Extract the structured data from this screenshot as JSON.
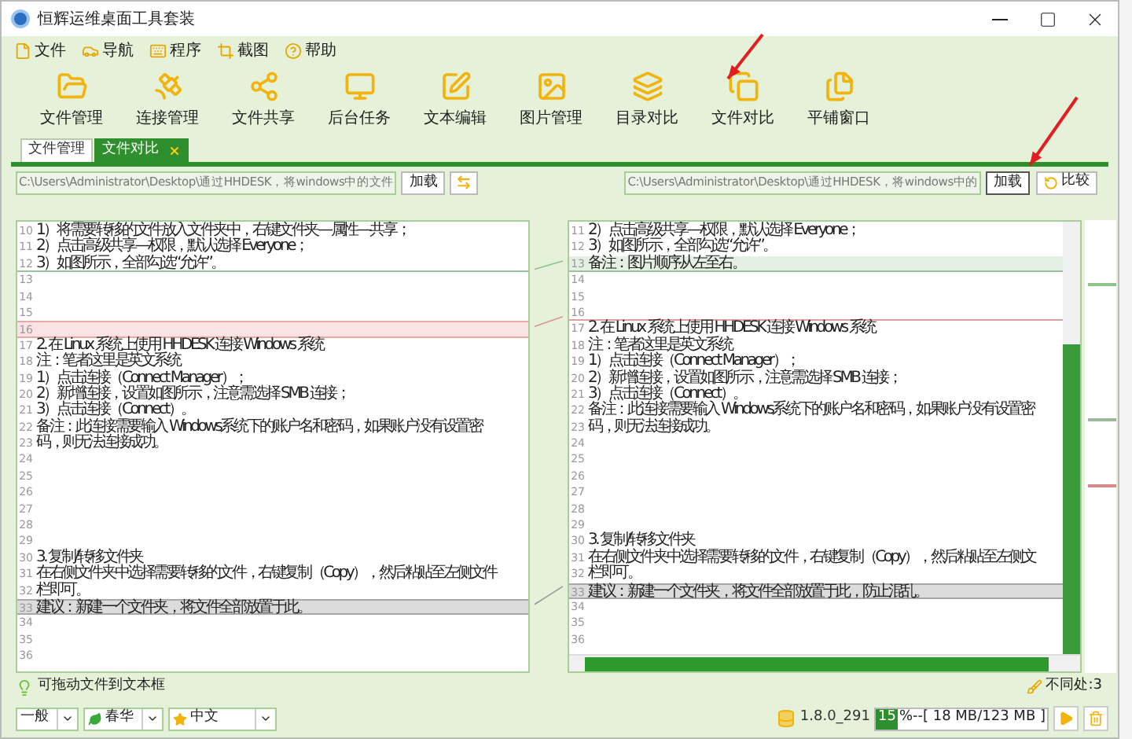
{
  "window": {
    "title": "恒辉运维桌面工具套装"
  },
  "menu": [
    "文件",
    "导航",
    "程序",
    "截图",
    "帮助"
  ],
  "toolbar": [
    "文件管理",
    "连接管理",
    "文件共享",
    "后台任务",
    "文本编辑",
    "图片管理",
    "目录对比",
    "文件对比",
    "平铺窗口"
  ],
  "tabs": [
    {
      "label": "文件管理",
      "selected": false,
      "closable": false
    },
    {
      "label": "文件对比",
      "selected": true,
      "closable": true
    }
  ],
  "left_path": {
    "value": "C:\\Users\\Administrator\\Desktop\\通过HHDESK，将windows中的文件",
    "load": "加载"
  },
  "right_path": {
    "value": "C:\\Users\\Administrator\\Desktop\\通过HHDESK，将windows中的",
    "load": "加载",
    "compare": "比较"
  },
  "left_editor": {
    "lines": [
      {
        "no": "10",
        "text": "1）将需要转移的文件放入文件夹中，右键文件夹—属性—共享；",
        "kind": "plain"
      },
      {
        "no": "11",
        "text": "2）点击高级共享—权限，默认选择 Everyone；",
        "kind": "plain"
      },
      {
        "no": "12",
        "text": "3）如图所示，全部勾选“允许”。",
        "kind": "gap_below"
      },
      {
        "no": "13",
        "kind": "plain"
      },
      {
        "no": "14",
        "kind": "plain"
      },
      {
        "no": "15",
        "kind": "plain"
      },
      {
        "no": "16",
        "kind": "removed"
      },
      {
        "no": "17",
        "text": "2. 在 Linux 系统上使用 HHDESK 连接 Windows 系统",
        "kind": "plain"
      },
      {
        "no": "18",
        "text": "注：笔者这里是英文系统",
        "kind": "plain"
      },
      {
        "no": "19",
        "text": "1）点击连接（Connect Manager）；",
        "kind": "plain"
      },
      {
        "no": "20",
        "text": "2）新增连接，设置如图所示，注意需选择 SMB 连接；",
        "kind": "plain"
      },
      {
        "no": "21",
        "text": "3）点击连接（Connect）。",
        "kind": "plain"
      },
      {
        "no": "22",
        "text": "备注：此连接需要输入 Windows系统下的账户名和密码，如果账户没有设置密",
        "kind": "plain"
      },
      {
        "no": "23",
        "text": "码，则无法连接成功。",
        "kind": "plain"
      },
      {
        "no": "24",
        "kind": "plain"
      },
      {
        "no": "25",
        "kind": "plain"
      },
      {
        "no": "26",
        "kind": "plain"
      },
      {
        "no": "27",
        "kind": "plain"
      },
      {
        "no": "28",
        "kind": "plain"
      },
      {
        "no": "29",
        "kind": "plain"
      },
      {
        "no": "30",
        "text": "3. 复制/转移文件夹",
        "kind": "plain"
      },
      {
        "no": "31",
        "text": "在右侧文件夹中选择需要转移的文件，右键复制（Copy），然后粘贴至左侧文件",
        "kind": "plain"
      },
      {
        "no": "32",
        "text": "栏即可。",
        "kind": "plain"
      },
      {
        "no": "33",
        "text": "建议：新建一个文件夹，将文件全部放置于此。",
        "kind": "changed"
      },
      {
        "no": "34",
        "kind": "plain"
      },
      {
        "no": "35",
        "kind": "plain"
      },
      {
        "no": "36",
        "kind": "plain"
      }
    ]
  },
  "right_editor": {
    "lines": [
      {
        "no": "11",
        "text": "2）点击高级共享—权限，默认选择 Everyone；",
        "kind": "plain"
      },
      {
        "no": "12",
        "text": "3）如图所示，全部勾选“允许”。",
        "kind": "plain"
      },
      {
        "no": "13",
        "text": "备注：图片顺序从左至右。",
        "kind": "added"
      },
      {
        "no": "14",
        "kind": "plain"
      },
      {
        "no": "15",
        "kind": "plain"
      },
      {
        "no": "16",
        "kind": "gap_below_removed"
      },
      {
        "no": "17",
        "text": "2. 在 Linux 系统上使用 HHDESK 连接 Windows 系统",
        "kind": "plain"
      },
      {
        "no": "18",
        "text": "注：笔者这里是英文系统",
        "kind": "plain"
      },
      {
        "no": "19",
        "text": "1）点击连接（Connect Manager）；",
        "kind": "plain"
      },
      {
        "no": "20",
        "text": "2）新增连接，设置如图所示，注意需选择 SMB 连接；",
        "kind": "plain"
      },
      {
        "no": "21",
        "text": "3）点击连接（Connect）。",
        "kind": "plain"
      },
      {
        "no": "22",
        "text": "备注：此连接需要输入 Windows系统下的账户名和密码，如果账户没有设置密",
        "kind": "plain"
      },
      {
        "no": "23",
        "text": "码，则无法连接成功。",
        "kind": "plain"
      },
      {
        "no": "24",
        "kind": "plain"
      },
      {
        "no": "25",
        "kind": "plain"
      },
      {
        "no": "26",
        "kind": "plain"
      },
      {
        "no": "27",
        "kind": "plain"
      },
      {
        "no": "28",
        "kind": "plain"
      },
      {
        "no": "29",
        "kind": "plain"
      },
      {
        "no": "30",
        "text": "3. 复制/转移文件夹",
        "kind": "plain"
      },
      {
        "no": "31",
        "text": "在右侧文件夹中选择需要转移的文件，右键复制（Copy），然后粘贴至左侧文",
        "kind": "plain"
      },
      {
        "no": "32",
        "text": "栏即可。",
        "kind": "plain"
      },
      {
        "no": "33",
        "text": "建议：新建一个文件夹，将文件全部放置于此，防止混乱。",
        "kind": "changed"
      },
      {
        "no": "34",
        "kind": "plain"
      },
      {
        "no": "35",
        "kind": "plain"
      },
      {
        "no": "36",
        "kind": "plain"
      }
    ]
  },
  "hint": "可拖动文件到文本框",
  "differences": "不同处:3",
  "selectors": [
    {
      "label": "一般",
      "kind": "plain"
    },
    {
      "label": "春华",
      "kind": "leaf"
    },
    {
      "label": "中文",
      "kind": "star"
    }
  ],
  "status": {
    "version": "1.8.0_291",
    "memory_percent": "15",
    "memory": "%--[ 18 MB/123 MB ]"
  }
}
